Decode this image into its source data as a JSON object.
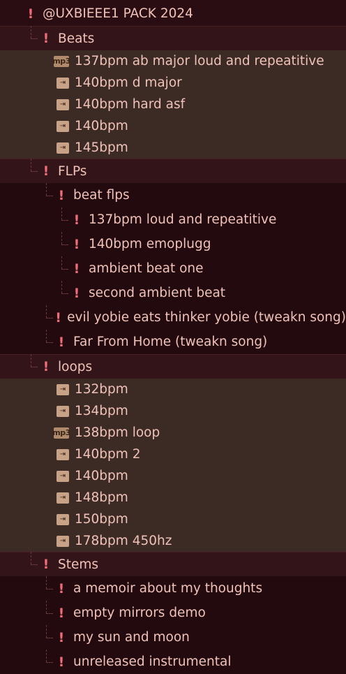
{
  "tree": [
    {
      "label": "@UXBIEEE1 PACK 2024",
      "type": "folder",
      "level": 0,
      "bg": "root",
      "icon": "folder-warning-icon"
    },
    {
      "label": "Beats",
      "type": "folder",
      "level": 1,
      "bg": "header",
      "icon": "folder-warning-icon"
    },
    {
      "label": "137bpm ab major loud and repeatitive",
      "type": "file",
      "level": 2,
      "bg": "beats",
      "icon": "mp3-file-icon",
      "badge": "mp3"
    },
    {
      "label": "140bpm d major",
      "type": "file",
      "level": 2,
      "bg": "beats",
      "icon": "flp-file-icon",
      "badge": "⇥"
    },
    {
      "label": "140bpm hard asf",
      "type": "file",
      "level": 2,
      "bg": "beats",
      "icon": "flp-file-icon",
      "badge": "⇥"
    },
    {
      "label": "140bpm",
      "type": "file",
      "level": 2,
      "bg": "beats",
      "icon": "flp-file-icon",
      "badge": "⇥"
    },
    {
      "label": "145bpm",
      "type": "file",
      "level": 2,
      "bg": "beats",
      "icon": "flp-file-icon",
      "badge": "⇥"
    },
    {
      "label": "FLPs",
      "type": "folder",
      "level": 1,
      "bg": "header",
      "icon": "folder-warning-icon"
    },
    {
      "label": "beat flps",
      "type": "folder",
      "level": 2,
      "bg": "dark",
      "icon": "folder-warning-icon"
    },
    {
      "label": "137bpm loud and repeatitive",
      "type": "folder",
      "level": 3,
      "bg": "dark",
      "icon": "folder-warning-icon"
    },
    {
      "label": "140bpm  emoplugg",
      "type": "folder",
      "level": 3,
      "bg": "dark",
      "icon": "folder-warning-icon"
    },
    {
      "label": "ambient beat one",
      "type": "folder",
      "level": 3,
      "bg": "dark",
      "icon": "folder-warning-icon"
    },
    {
      "label": "second ambient beat",
      "type": "folder",
      "level": 3,
      "bg": "dark",
      "icon": "folder-warning-icon"
    },
    {
      "label": "evil yobie eats thinker yobie (tweakn song)",
      "type": "folder",
      "level": 2,
      "bg": "dark",
      "icon": "folder-warning-icon"
    },
    {
      "label": "Far From Home (tweakn song)",
      "type": "folder",
      "level": 2,
      "bg": "dark",
      "icon": "folder-warning-icon"
    },
    {
      "label": "loops",
      "type": "folder",
      "level": 1,
      "bg": "header",
      "icon": "folder-warning-icon"
    },
    {
      "label": "132bpm",
      "type": "file",
      "level": 2,
      "bg": "loops",
      "icon": "flp-file-icon",
      "badge": "⇥"
    },
    {
      "label": "134bpm",
      "type": "file",
      "level": 2,
      "bg": "loops",
      "icon": "flp-file-icon",
      "badge": "⇥"
    },
    {
      "label": "138bpm loop",
      "type": "file",
      "level": 2,
      "bg": "loops",
      "icon": "mp3-file-icon",
      "badge": "mp3"
    },
    {
      "label": "140bpm 2",
      "type": "file",
      "level": 2,
      "bg": "loops",
      "icon": "flp-file-icon",
      "badge": "⇥"
    },
    {
      "label": "140bpm",
      "type": "file",
      "level": 2,
      "bg": "loops",
      "icon": "flp-file-icon",
      "badge": "⇥"
    },
    {
      "label": "148bpm",
      "type": "file",
      "level": 2,
      "bg": "loops",
      "icon": "flp-file-icon",
      "badge": "⇥"
    },
    {
      "label": "150bpm",
      "type": "file",
      "level": 2,
      "bg": "loops",
      "icon": "flp-file-icon",
      "badge": "⇥"
    },
    {
      "label": "178bpm 450hz",
      "type": "file",
      "level": 2,
      "bg": "loops",
      "icon": "flp-file-icon",
      "badge": "⇥"
    },
    {
      "label": "Stems",
      "type": "folder",
      "level": 1,
      "bg": "header",
      "icon": "folder-warning-icon"
    },
    {
      "label": "a memoir about my thoughts",
      "type": "folder",
      "level": 2,
      "bg": "dark",
      "icon": "folder-warning-icon"
    },
    {
      "label": "empty mirrors demo",
      "type": "folder",
      "level": 2,
      "bg": "dark",
      "icon": "folder-warning-icon"
    },
    {
      "label": "my sun and moon",
      "type": "folder",
      "level": 2,
      "bg": "dark",
      "icon": "folder-warning-icon"
    },
    {
      "label": "unreleased instrumental",
      "type": "folder",
      "level": 2,
      "bg": "dark",
      "icon": "folder-warning-icon"
    }
  ],
  "colors": {
    "warning": "#ef6d78",
    "text": "#f0c2b8",
    "background": "#2a0d12",
    "file_section": "#3c2b25"
  }
}
